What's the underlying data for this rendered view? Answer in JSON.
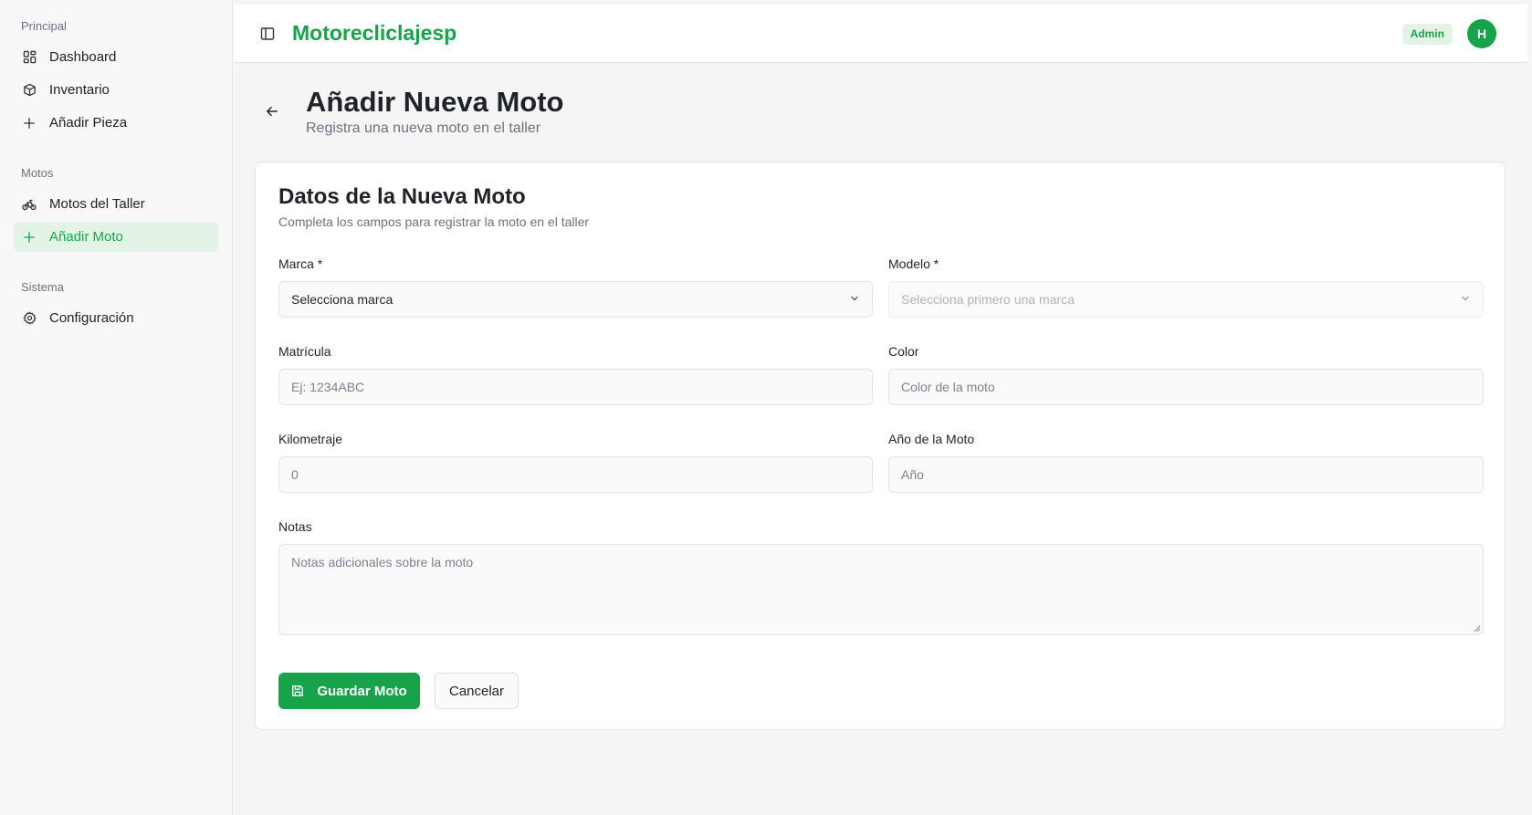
{
  "app": {
    "brand": "Motorecliclajesp"
  },
  "sidebar": {
    "groups": [
      {
        "label": "Principal",
        "items": [
          {
            "label": "Dashboard",
            "icon": "dashboard-icon"
          },
          {
            "label": "Inventario",
            "icon": "package-icon"
          },
          {
            "label": "Añadir Pieza",
            "icon": "plus-icon"
          }
        ]
      },
      {
        "label": "Motos",
        "items": [
          {
            "label": "Motos del Taller",
            "icon": "bike-icon"
          },
          {
            "label": "Añadir Moto",
            "icon": "plus-icon",
            "active": true
          }
        ]
      },
      {
        "label": "Sistema",
        "items": [
          {
            "label": "Configuración",
            "icon": "gear-icon"
          }
        ]
      }
    ]
  },
  "header": {
    "role_badge": "Admin",
    "avatar_initial": "H"
  },
  "page": {
    "title": "Añadir Nueva Moto",
    "subtitle": "Registra una nueva moto en el taller"
  },
  "form": {
    "title": "Datos de la Nueva Moto",
    "subtitle": "Completa los campos para registrar la moto en el taller",
    "marca": {
      "label": "Marca *",
      "value": "Selecciona marca"
    },
    "modelo": {
      "label": "Modelo *",
      "value": "Selecciona primero una marca"
    },
    "matricula": {
      "label": "Matrícula",
      "placeholder": "Ej: 1234ABC"
    },
    "color": {
      "label": "Color",
      "placeholder": "Color de la moto"
    },
    "kilometraje": {
      "label": "Kilometraje",
      "placeholder": "0"
    },
    "anio": {
      "label": "Año de la Moto",
      "placeholder": "Año"
    },
    "notas": {
      "label": "Notas",
      "placeholder": "Notas adicionales sobre la moto"
    },
    "save_label": "Guardar Moto",
    "cancel_label": "Cancelar"
  },
  "colors": {
    "accent": "#16a34a",
    "accent_soft": "#e3f4e7"
  }
}
